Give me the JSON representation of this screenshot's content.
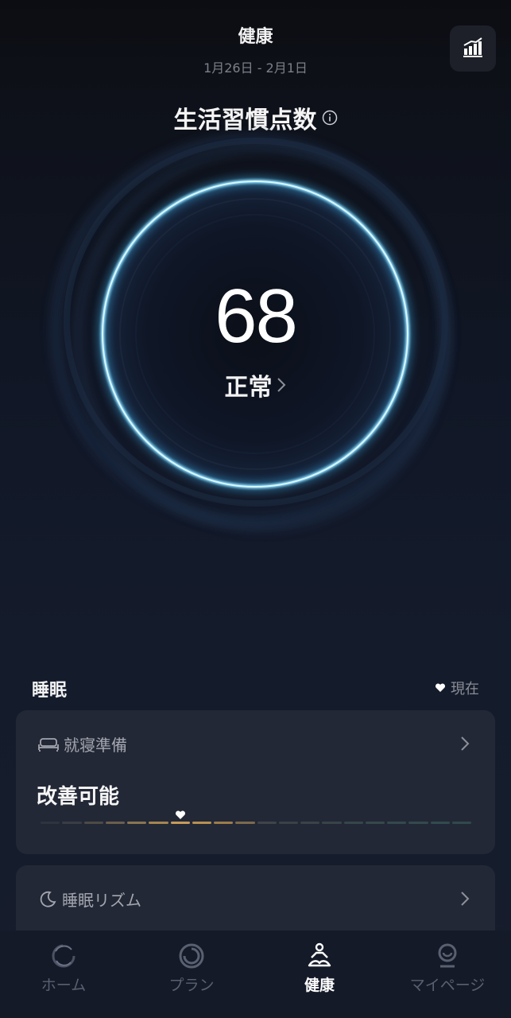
{
  "header": {
    "title": "健康",
    "date_range": "1月26日 - 2月1日",
    "trend_button_icon": "bar-chart-trend-icon"
  },
  "score": {
    "title": "生活習慣点数",
    "info_icon": "info-icon",
    "value": "68",
    "status": "正常",
    "ring_color": "#8fe0ff"
  },
  "sleep_section": {
    "title": "睡眠",
    "now_label": "現在",
    "cards": [
      {
        "icon": "bed-icon",
        "label": "就寝準備",
        "status": "改善可能",
        "segment_count": 20,
        "current_segment": 6,
        "segment_colors": [
          "#2f343f",
          "#3a3d45",
          "#4d4a45",
          "#6b5f4c",
          "#8a7550",
          "#a4854f",
          "#c79a58",
          "#b8904f",
          "#9b7c4a",
          "#7c6a4b",
          "#3e4448",
          "#3a4246",
          "#3a4348",
          "#384448",
          "#36464a",
          "#36484b",
          "#34494c",
          "#334a4d",
          "#324a4d",
          "#31494c"
        ]
      },
      {
        "icon": "moon-icon",
        "label": "睡眠リズム"
      }
    ]
  },
  "tabbar": {
    "tabs": [
      {
        "label": "ホーム",
        "icon": "home-swirl-icon",
        "active": false
      },
      {
        "label": "プラン",
        "icon": "plan-ring-icon",
        "active": false
      },
      {
        "label": "健康",
        "icon": "meditation-person-icon",
        "active": true
      },
      {
        "label": "マイページ",
        "icon": "profile-icon",
        "active": false
      }
    ]
  }
}
